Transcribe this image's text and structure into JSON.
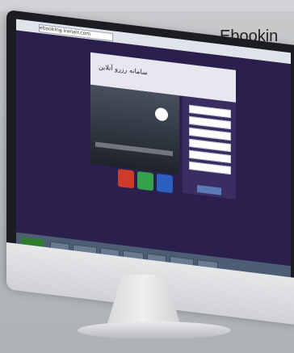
{
  "hero_label": {
    "text": "Ebookin"
  },
  "banner": {
    "title": "سامانه رزرو آنلاین"
  },
  "browser": {
    "url": "ebooking.iranair.com"
  },
  "icons": {
    "start": "start-button-icon",
    "badge": "badge-icon",
    "red_tile": "flight-icon",
    "green_tile": "offer-icon",
    "blue_tile": "booking-icon"
  }
}
